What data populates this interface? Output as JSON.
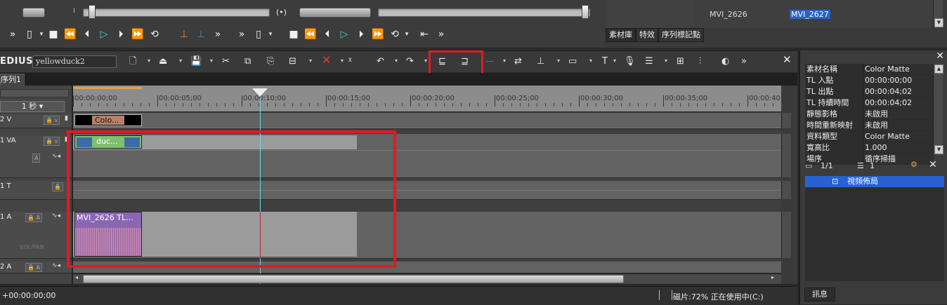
{
  "app": {
    "title": "EDIUS",
    "project_name": "yellowduck2"
  },
  "bin": {
    "clips": [
      {
        "name": "MVI_2626",
        "selected": false
      },
      {
        "name": "MVI_2627",
        "selected": true
      }
    ],
    "tabs": [
      "素材庫",
      "特效",
      "序列標記點"
    ]
  },
  "player": {
    "jog_label": "(•)"
  },
  "sequence": {
    "tab_label": "序列1"
  },
  "timeline": {
    "scale": "1 秒",
    "timecodes": [
      "00:00:00;00",
      "00:00:05;00",
      "00:00:10;00",
      "00:00:15;00",
      "00:00:20;00",
      "00:00:25;00",
      "00:00:30;00",
      "00:00:35;00",
      "00:00:40"
    ],
    "tracks": [
      {
        "name": "2 V"
      },
      {
        "name": "1 VA"
      },
      {
        "name": "1 T"
      },
      {
        "name": "1 A"
      },
      {
        "name": "2 A"
      }
    ],
    "clips": {
      "color_matte": "Colo...",
      "duck": "duc...",
      "audio": "MVI_2626   TL..."
    },
    "vol_pan": "VOL/PAN"
  },
  "info": {
    "rows": [
      {
        "key": "素材名稱",
        "value": "Color Matte"
      },
      {
        "key": "TL 入點",
        "value": "00:00:00;00"
      },
      {
        "key": "TL 出點",
        "value": "00:00:04;02"
      },
      {
        "key": "TL 持續時間",
        "value": "00:00:04;02"
      },
      {
        "key": "靜態影格",
        "value": "未啟用"
      },
      {
        "key": "時間重新映射",
        "value": "未啟用"
      },
      {
        "key": "資料類型",
        "value": "Color Matte"
      },
      {
        "key": "寬高比",
        "value": "1.000"
      },
      {
        "key": "場序",
        "value": "循序掃描"
      }
    ],
    "page": "1/1",
    "count": "1",
    "layout_item": "視頻佈局",
    "tab": "訊息"
  },
  "status": {
    "timecode": "+00:00:00;00",
    "disk": "磁片:72% 正在使用中(C:)"
  }
}
